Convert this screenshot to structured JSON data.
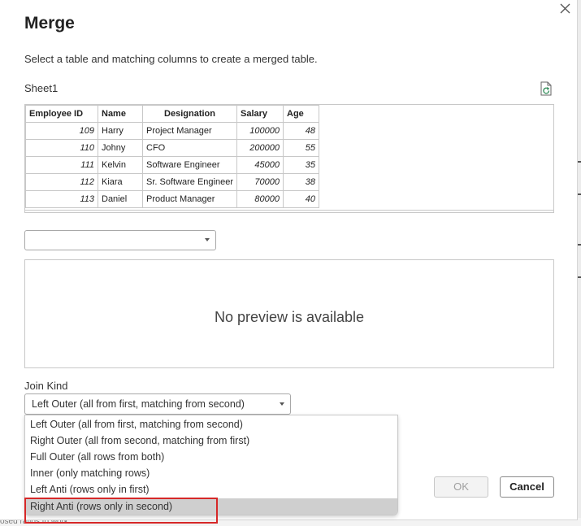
{
  "dialog": {
    "title": "Merge",
    "subtitle": "Select a table and matching columns to create a merged table.",
    "table_name": "Sheet1"
  },
  "table": {
    "headers": [
      "Employee ID",
      "Name",
      "Designation",
      "Salary",
      "Age"
    ],
    "rows": [
      {
        "employee_id": "109",
        "name": "Harry",
        "designation": "Project Manager",
        "salary": "100000",
        "age": "48"
      },
      {
        "employee_id": "110",
        "name": "Johny",
        "designation": "CFO",
        "salary": "200000",
        "age": "55"
      },
      {
        "employee_id": "111",
        "name": "Kelvin",
        "designation": "Software Engineer",
        "salary": "45000",
        "age": "35"
      },
      {
        "employee_id": "112",
        "name": "Kiara",
        "designation": "Sr. Software Engineer",
        "salary": "70000",
        "age": "38"
      },
      {
        "employee_id": "113",
        "name": "Daniel",
        "designation": "Product Manager",
        "salary": "80000",
        "age": "40"
      }
    ]
  },
  "second_table_select": {
    "value": ""
  },
  "second_preview": {
    "message": "No preview is available"
  },
  "join_kind": {
    "label": "Join Kind",
    "selected": "Left Outer (all from first, matching from second)",
    "options": [
      "Left Outer (all from first, matching from second)",
      "Right Outer (all from second, matching from first)",
      "Full Outer (all rows from both)",
      "Inner (only matching rows)",
      "Left Anti (rows only in first)",
      "Right Anti (rows only in second)"
    ],
    "hovered_index": 5
  },
  "buttons": {
    "ok": "OK",
    "cancel": "Cancel"
  },
  "icons": {
    "close": "close-icon",
    "refresh": "refresh-icon",
    "dropdown": "chevron-down-icon"
  },
  "colors": {
    "highlight": "#d62828",
    "hover_row": "#cfcfcf"
  },
  "background": {
    "bottom_text": "osed ratios to work"
  }
}
